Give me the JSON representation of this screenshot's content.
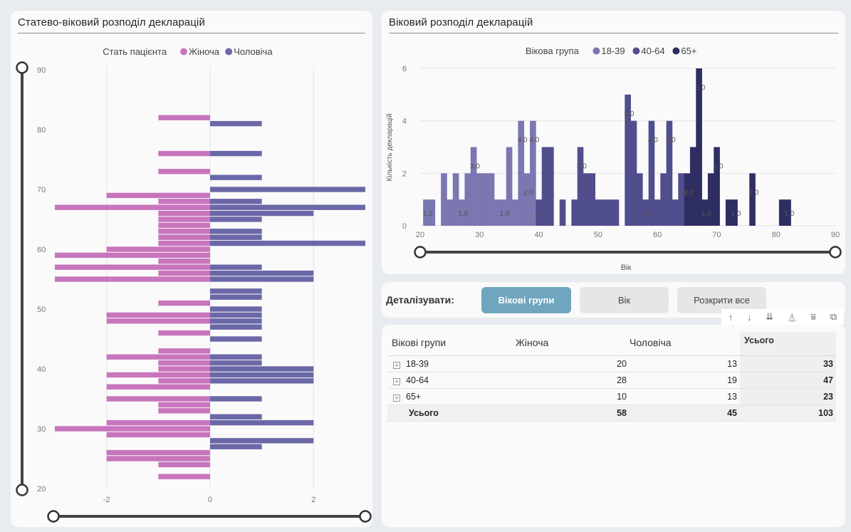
{
  "left_panel": {
    "title": "Статево-віковий розподіл декларацій",
    "legend_title": "Стать пацієнта",
    "legend": [
      {
        "label": "Жіноча",
        "color": "#c875bd"
      },
      {
        "label": "Чоловіча",
        "color": "#6b68a8"
      }
    ]
  },
  "hist_panel": {
    "title": "Віковий розподіл декларацій",
    "legend_title": "Вікова група",
    "legend": [
      {
        "label": "18-39",
        "color": "#7a77b1"
      },
      {
        "label": "40-64",
        "color": "#504e8d"
      },
      {
        "label": "65+",
        "color": "#2e2e63"
      }
    ]
  },
  "drill": {
    "label": "Деталізувати:",
    "buttons": [
      "Вікові групи",
      "Вік",
      "Розкрити все"
    ]
  },
  "toolbar": {
    "icons": [
      "arrow-up-icon",
      "arrow-down-icon",
      "double-arrow-down-icon",
      "hierarchy-icon",
      "filter-icon",
      "focus-mode-icon"
    ]
  },
  "matrix": {
    "headers": [
      "Вікові групи",
      "Жіноча",
      "Чоловіча",
      "Усього"
    ],
    "rows": [
      {
        "group": "18-39",
        "female": "20",
        "male": "13",
        "total": "33"
      },
      {
        "group": "40-64",
        "female": "28",
        "male": "19",
        "total": "47"
      },
      {
        "group": "65+",
        "female": "10",
        "male": "13",
        "total": "23"
      }
    ],
    "total_row": {
      "label": "Усього",
      "female": "58",
      "male": "45",
      "total": "103"
    }
  },
  "chart_data": [
    {
      "type": "bar",
      "orientation": "horizontal",
      "ylabel": "",
      "xlabel": "",
      "ylim": [
        20,
        90
      ],
      "xlim": [
        -3,
        3
      ],
      "y_ticks": [
        20,
        30,
        40,
        50,
        60,
        70,
        80,
        90
      ],
      "x_ticks": [
        -2,
        0,
        2
      ],
      "grid": true,
      "legend_position": "top-center",
      "series": [
        {
          "name": "Жіноча",
          "color": "#c875bd",
          "points": [
            [
              22,
              -1
            ],
            [
              24,
              -1
            ],
            [
              25,
              -2
            ],
            [
              26,
              -2
            ],
            [
              29,
              -2
            ],
            [
              30,
              -3
            ],
            [
              31,
              -2
            ],
            [
              33,
              -1
            ],
            [
              34,
              -1
            ],
            [
              35,
              -2
            ],
            [
              37,
              -2
            ],
            [
              38,
              -1
            ],
            [
              39,
              -2
            ],
            [
              40,
              -1
            ],
            [
              41,
              -1
            ],
            [
              42,
              -2
            ],
            [
              43,
              -1
            ],
            [
              46,
              -1
            ],
            [
              48,
              -2
            ],
            [
              49,
              -2
            ],
            [
              51,
              -1
            ],
            [
              55,
              -3
            ],
            [
              56,
              -1
            ],
            [
              57,
              -3
            ],
            [
              58,
              -1
            ],
            [
              59,
              -3
            ],
            [
              60,
              -2
            ],
            [
              61,
              -1
            ],
            [
              62,
              -1
            ],
            [
              63,
              -1
            ],
            [
              64,
              -1
            ],
            [
              65,
              -1
            ],
            [
              66,
              -1
            ],
            [
              67,
              -3
            ],
            [
              68,
              -1
            ],
            [
              69,
              -2
            ],
            [
              73,
              -1
            ],
            [
              76,
              -1
            ],
            [
              82,
              -1
            ]
          ]
        },
        {
          "name": "Чоловіча",
          "color": "#6b68a8",
          "points": [
            [
              27,
              1
            ],
            [
              28,
              2
            ],
            [
              31,
              2
            ],
            [
              32,
              1
            ],
            [
              35,
              1
            ],
            [
              38,
              2
            ],
            [
              39,
              2
            ],
            [
              40,
              2
            ],
            [
              41,
              1
            ],
            [
              42,
              1
            ],
            [
              45,
              1
            ],
            [
              47,
              1
            ],
            [
              48,
              1
            ],
            [
              49,
              1
            ],
            [
              50,
              1
            ],
            [
              52,
              1
            ],
            [
              53,
              1
            ],
            [
              55,
              2
            ],
            [
              56,
              2
            ],
            [
              57,
              1
            ],
            [
              61,
              3
            ],
            [
              62,
              1
            ],
            [
              63,
              1
            ],
            [
              65,
              1
            ],
            [
              66,
              2
            ],
            [
              67,
              3
            ],
            [
              68,
              1
            ],
            [
              70,
              3
            ],
            [
              72,
              1
            ],
            [
              76,
              1
            ],
            [
              81,
              1
            ]
          ]
        }
      ]
    },
    {
      "type": "bar",
      "xlabel": "Вік",
      "ylabel": "Кількість декларацій",
      "xlim": [
        20,
        90
      ],
      "ylim": [
        0,
        6
      ],
      "x_ticks": [
        20,
        30,
        40,
        50,
        60,
        70,
        80,
        90
      ],
      "y_ticks": [
        0,
        2,
        4,
        6
      ],
      "grid": true,
      "legend_position": "top-center",
      "series": [
        {
          "name": "18-39",
          "color": "#7a77b1",
          "points": [
            [
              21,
              1
            ],
            [
              22,
              1
            ],
            [
              24,
              2
            ],
            [
              25,
              1
            ],
            [
              26,
              2
            ],
            [
              27,
              1
            ],
            [
              28,
              2
            ],
            [
              29,
              3
            ],
            [
              30,
              2
            ],
            [
              31,
              2
            ],
            [
              32,
              2
            ],
            [
              33,
              1
            ],
            [
              34,
              1
            ],
            [
              35,
              3
            ],
            [
              36,
              1
            ],
            [
              37,
              4
            ],
            [
              38,
              2
            ],
            [
              39,
              4
            ]
          ]
        },
        {
          "name": "40-64",
          "color": "#504e8d",
          "points": [
            [
              40,
              1
            ],
            [
              41,
              3
            ],
            [
              42,
              3
            ],
            [
              44,
              1
            ],
            [
              46,
              1
            ],
            [
              47,
              3
            ],
            [
              48,
              2
            ],
            [
              49,
              2
            ],
            [
              50,
              1
            ],
            [
              51,
              1
            ],
            [
              52,
              1
            ],
            [
              53,
              1
            ],
            [
              55,
              5
            ],
            [
              56,
              4
            ],
            [
              57,
              2
            ],
            [
              58,
              1
            ],
            [
              59,
              4
            ],
            [
              60,
              1
            ],
            [
              61,
              2
            ],
            [
              62,
              4
            ],
            [
              63,
              1
            ],
            [
              64,
              2
            ]
          ]
        },
        {
          "name": "65+",
          "color": "#2e2e63",
          "points": [
            [
              65,
              2
            ],
            [
              66,
              3
            ],
            [
              67,
              6
            ],
            [
              68,
              1
            ],
            [
              69,
              2
            ],
            [
              70,
              3
            ],
            [
              72,
              1
            ],
            [
              73,
              1
            ],
            [
              76,
              2
            ],
            [
              81,
              1
            ],
            [
              82,
              1
            ]
          ]
        }
      ],
      "data_labels": [
        {
          "x": 21,
          "label": "1.0"
        },
        {
          "x": 27,
          "label": "1.0"
        },
        {
          "x": 29,
          "label": "3.0"
        },
        {
          "x": 34,
          "label": "1.0"
        },
        {
          "x": 37,
          "label": "4.0"
        },
        {
          "x": 38,
          "label": "2.0"
        },
        {
          "x": 39,
          "label": "4.0"
        },
        {
          "x": 40,
          "label": "1.0"
        },
        {
          "x": 47,
          "label": "3.0"
        },
        {
          "x": 55,
          "label": "5.0"
        },
        {
          "x": 58,
          "label": "1.0"
        },
        {
          "x": 59,
          "label": "4.0"
        },
        {
          "x": 62,
          "label": "4.0"
        },
        {
          "x": 64,
          "label": "1.0"
        },
        {
          "x": 65,
          "label": "2.0"
        },
        {
          "x": 67,
          "label": "3.0"
        },
        {
          "x": 68,
          "label": "1.0"
        },
        {
          "x": 70,
          "label": "2.0"
        },
        {
          "x": 73,
          "label": "1.0"
        },
        {
          "x": 76,
          "label": "2.0"
        },
        {
          "x": 82,
          "label": "1.0"
        }
      ]
    }
  ]
}
